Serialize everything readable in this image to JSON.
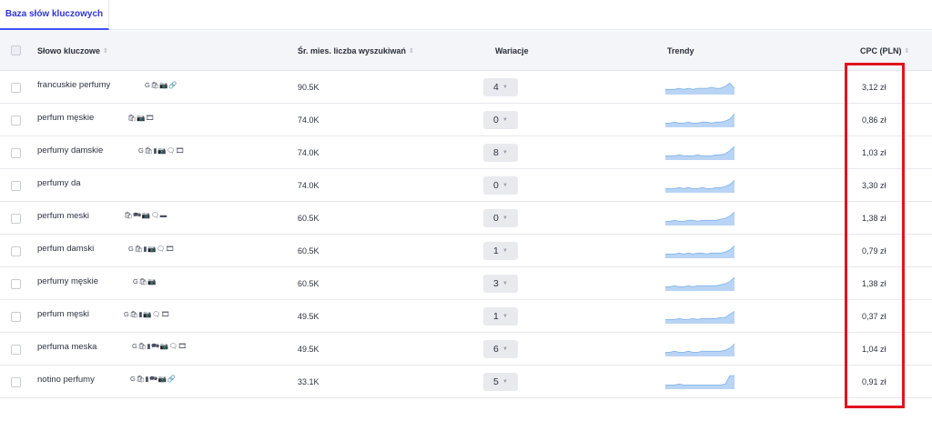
{
  "tabs": [
    {
      "label": "Baza słów kluczowych"
    }
  ],
  "columns": {
    "keyword": "Słowo kluczowe",
    "volume": "Śr. mies. liczba wyszukiwań",
    "variations": "Wariacje",
    "trends": "Trendy",
    "cpc": "CPC (PLN)"
  },
  "rows": [
    {
      "keyword": "francuskie perfumy",
      "features": "G🛍📷🔗",
      "volume": "90.5K",
      "variations": "4",
      "cpc": "3,12 zł",
      "trend": [
        5,
        5,
        5,
        6,
        5,
        6,
        5,
        6,
        6,
        6,
        7,
        6,
        6,
        8,
        11,
        6
      ]
    },
    {
      "keyword": "perfum męskie",
      "features": "🛍📷🎞",
      "volume": "74.0K",
      "variations": "0",
      "cpc": "0,86 zł",
      "trend": [
        4,
        4,
        5,
        4,
        4,
        5,
        4,
        4,
        5,
        5,
        4,
        5,
        5,
        6,
        8,
        13
      ]
    },
    {
      "keyword": "perfumy damskie",
      "features": "G🛍▮📷🗨🎞",
      "volume": "74.0K",
      "variations": "8",
      "cpc": "1,03 zł",
      "trend": [
        4,
        4,
        4,
        5,
        4,
        4,
        4,
        5,
        4,
        4,
        4,
        5,
        5,
        6,
        9,
        13
      ]
    },
    {
      "keyword": "perfumy da",
      "features": "",
      "volume": "74.0K",
      "variations": "0",
      "cpc": "3,30 zł",
      "trend": [
        4,
        4,
        4,
        5,
        4,
        5,
        4,
        4,
        5,
        4,
        4,
        5,
        5,
        6,
        8,
        12
      ]
    },
    {
      "keyword": "perfum meski",
      "features": "🛍🗪📷🗨▬",
      "volume": "60.5K",
      "variations": "0",
      "cpc": "1,38 zł",
      "trend": [
        4,
        4,
        5,
        4,
        4,
        5,
        5,
        4,
        5,
        5,
        5,
        5,
        6,
        7,
        9,
        13
      ]
    },
    {
      "keyword": "perfum damski",
      "features": "G🛍▮📷🗨🎞",
      "volume": "60.5K",
      "variations": "1",
      "cpc": "0,79 zł",
      "trend": [
        4,
        4,
        4,
        5,
        4,
        5,
        4,
        5,
        5,
        4,
        5,
        5,
        5,
        6,
        8,
        12
      ]
    },
    {
      "keyword": "perfumy męskie",
      "features": "G🛍📷",
      "volume": "60.5K",
      "variations": "3",
      "cpc": "1,38 zł",
      "trend": [
        4,
        4,
        5,
        4,
        4,
        5,
        4,
        5,
        5,
        5,
        5,
        5,
        6,
        7,
        9,
        13
      ]
    },
    {
      "keyword": "perfum męski",
      "features": "G🛍▮📷🗨🎞",
      "volume": "49.5K",
      "variations": "1",
      "cpc": "0,37 zł",
      "trend": [
        4,
        4,
        4,
        5,
        4,
        4,
        5,
        4,
        5,
        5,
        5,
        5,
        6,
        6,
        9,
        12
      ]
    },
    {
      "keyword": "perfuma meska",
      "features": "G🛍▮🗪📷🗨🎞",
      "volume": "49.5K",
      "variations": "6",
      "cpc": "1,04 zł",
      "trend": [
        4,
        4,
        5,
        4,
        4,
        5,
        4,
        4,
        5,
        5,
        5,
        5,
        5,
        6,
        8,
        12
      ]
    },
    {
      "keyword": "notino perfumy",
      "features": "G🛍▮🗪📷🔗",
      "volume": "33.1K",
      "variations": "5",
      "cpc": "0,91 zł",
      "trend": [
        4,
        4,
        4,
        5,
        4,
        4,
        4,
        4,
        4,
        4,
        4,
        4,
        4,
        5,
        13,
        13
      ]
    }
  ],
  "colors": {
    "accent": "#3f51ff",
    "highlight": "#e0141e",
    "sparkline_fill": "#b9d4f4",
    "sparkline_line": "#7fb2ea"
  }
}
